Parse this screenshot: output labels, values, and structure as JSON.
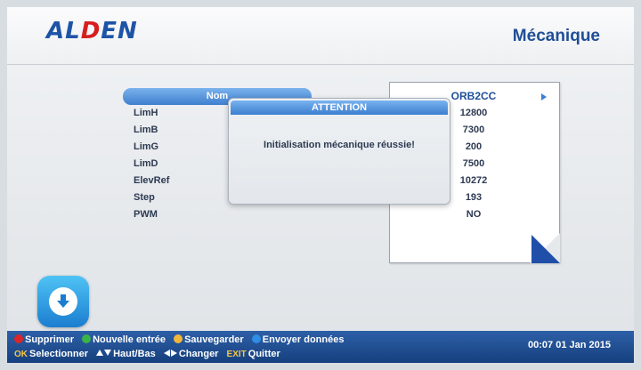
{
  "header": {
    "logo_part1": "AL",
    "logo_part2": "D",
    "logo_part3": "EN",
    "title": "Mécanique"
  },
  "params": {
    "labels": [
      "Nom",
      "LimH",
      "LimB",
      "LimG",
      "LimD",
      "ElevRef",
      "Step",
      "PWM"
    ],
    "values": [
      "ORB2CC",
      "12800",
      "7300",
      "200",
      "7500",
      "10272",
      "193",
      "NO"
    ],
    "selected_index": 0
  },
  "dialog": {
    "title": "ATTENTION",
    "message": "Initialisation mécanique réussie!"
  },
  "footer": {
    "legend": [
      {
        "label": "Supprimer",
        "color": "#d9262b"
      },
      {
        "label": "Nouvelle entrée",
        "color": "#3bb34a"
      },
      {
        "label": "Sauvegarder",
        "color": "#f2b63a"
      },
      {
        "label": "Envoyer données",
        "color": "#2f8de4"
      }
    ],
    "ok_key": "OK",
    "ok_label": "Selectionner",
    "updown_label": "Haut/Bas",
    "leftright_label": "Changer",
    "exit_key": "EXIT",
    "exit_label": "Quitter",
    "datetime": "00:07  01 Jan 2015"
  },
  "icons": {
    "badge": "download-icon",
    "selector": "arrow-right-icon"
  }
}
